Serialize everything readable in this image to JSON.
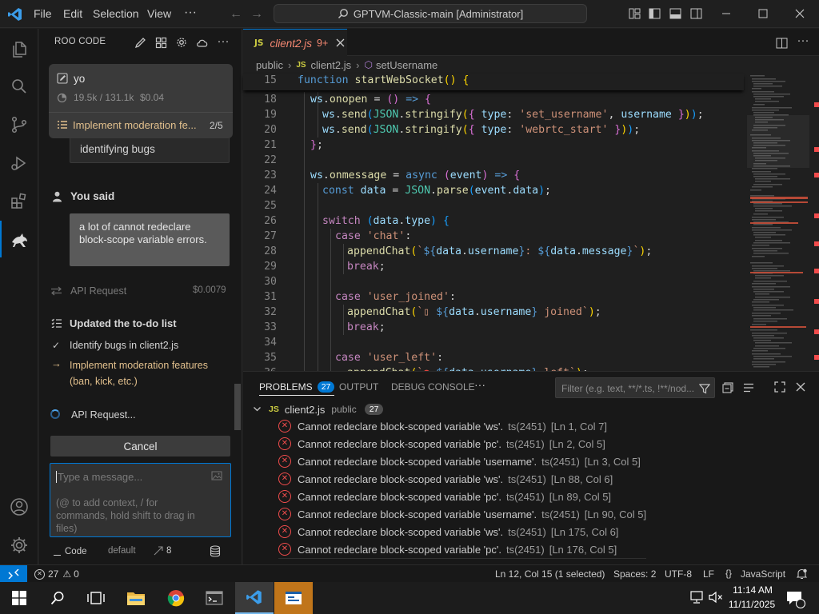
{
  "titlebar": {
    "menu": [
      "File",
      "Edit",
      "Selection",
      "View",
      "···"
    ],
    "command_center": "GPTVM-Classic-main [Administrator]"
  },
  "sidebar": {
    "title": "ROO CODE",
    "task": {
      "title": "yo",
      "tokens": "19.5k / 131.1k",
      "cost": "$0.04",
      "todo_current": "Implement moderation fe...",
      "todo_progress": "2/5"
    },
    "chat": {
      "partial_text": "identifying bugs",
      "you_said_label": "You said",
      "user_message": "a lot of cannot redeclare block-scope variable errors.",
      "api_request_1": {
        "label": "API Request",
        "cost": "$0.0079"
      },
      "todo_header": "Updated the to-do list",
      "todos": [
        {
          "label": "Identify bugs in client2.js",
          "state": "done"
        },
        {
          "label": "Implement moderation features (ban, kick, etc.)",
          "state": "in-progress"
        }
      ],
      "api_request_2": "API Request..."
    },
    "cancel_label": "Cancel",
    "input": {
      "placeholder": "Type a message...",
      "hint": "(@ to add context, / for commands, hold shift to drag in files)"
    },
    "footer": {
      "mode": "Code",
      "profile": "default",
      "count": "8"
    }
  },
  "editor": {
    "tab": {
      "name": "client2.js",
      "badge": "9+"
    },
    "breadcrumb": [
      "public",
      "client2.js",
      "setUsername"
    ],
    "sticky": {
      "number": "15",
      "text": "function startWebSocket() {"
    },
    "lines": [
      {
        "n": "18"
      },
      {
        "n": "19"
      },
      {
        "n": "20"
      },
      {
        "n": "21"
      },
      {
        "n": "22"
      },
      {
        "n": "23"
      },
      {
        "n": "24"
      },
      {
        "n": "25"
      },
      {
        "n": "26"
      },
      {
        "n": "27"
      },
      {
        "n": "28"
      },
      {
        "n": "29"
      },
      {
        "n": "30"
      },
      {
        "n": "31"
      },
      {
        "n": "32"
      },
      {
        "n": "33"
      },
      {
        "n": "34"
      },
      {
        "n": "35"
      },
      {
        "n": "36"
      }
    ]
  },
  "panel": {
    "tabs": [
      {
        "label": "PROBLEMS",
        "count": "27",
        "active": true
      },
      {
        "label": "OUTPUT"
      },
      {
        "label": "DEBUG CONSOLE"
      }
    ],
    "filter_placeholder": "Filter (e.g. text, **/*.ts, !**/nod...",
    "file": {
      "name": "client2.js",
      "folder": "public",
      "count": "27"
    },
    "problems": [
      {
        "message": "Cannot redeclare block-scoped variable 'ws'.",
        "source": "ts(2451)",
        "location": "[Ln 1, Col 7]"
      },
      {
        "message": "Cannot redeclare block-scoped variable 'pc'.",
        "source": "ts(2451)",
        "location": "[Ln 2, Col 5]"
      },
      {
        "message": "Cannot redeclare block-scoped variable 'username'.",
        "source": "ts(2451)",
        "location": "[Ln 3, Col 5]"
      },
      {
        "message": "Cannot redeclare block-scoped variable 'ws'.",
        "source": "ts(2451)",
        "location": "[Ln 88, Col 6]"
      },
      {
        "message": "Cannot redeclare block-scoped variable 'pc'.",
        "source": "ts(2451)",
        "location": "[Ln 89, Col 5]"
      },
      {
        "message": "Cannot redeclare block-scoped variable 'username'.",
        "source": "ts(2451)",
        "location": "[Ln 90, Col 5]"
      },
      {
        "message": "Cannot redeclare block-scoped variable 'ws'.",
        "source": "ts(2451)",
        "location": "[Ln 175, Col 6]"
      },
      {
        "message": "Cannot redeclare block-scoped variable 'pc'.",
        "source": "ts(2451)",
        "location": "[Ln 176, Col 5]"
      }
    ]
  },
  "statusbar": {
    "errors": "27",
    "warnings": "0",
    "position": "Ln 12, Col 15 (1 selected)",
    "spaces": "Spaces: 2",
    "encoding": "UTF-8",
    "eol": "LF",
    "language": "JavaScript"
  },
  "taskbar": {
    "time": "11:14 AM",
    "date": "11/11/2025"
  },
  "colors": {
    "accent": "#0078d4",
    "error": "#f14c4c",
    "todo_in_progress": "#e2c08d",
    "status_bar": "#181818",
    "taskbar": "#1c1c1c"
  }
}
